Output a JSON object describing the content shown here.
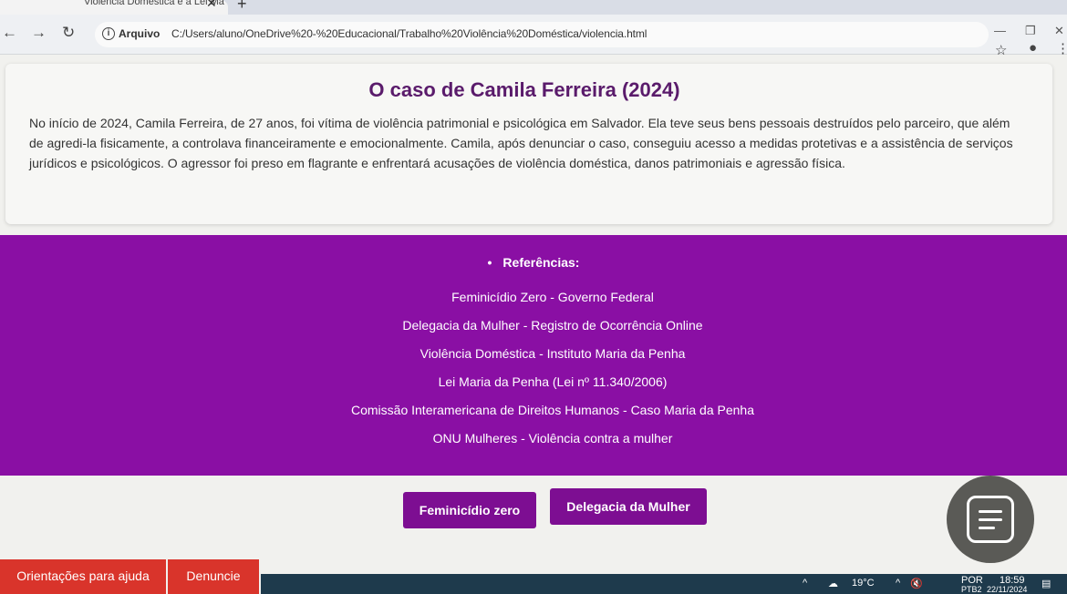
{
  "browser": {
    "tab_title": "Violência Doméstica e a Lei Ma",
    "address_scheme": "Arquivo",
    "url": "C:/Users/aluno/OneDrive%20-%20Educacional/Trabalho%20Violência%20Doméstica/violencia.html"
  },
  "case": {
    "title": "O caso de Camila Ferreira (2024)",
    "text": "No início de 2024, Camila Ferreira, de 27 anos, foi vítima de violência patrimonial e psicológica em Salvador. Ela teve seus bens pessoais destruídos pelo parceiro, que além de agredi-la fisicamente, a controlava financeiramente e emocionalmente. Camila, após denunciar o caso, conseguiu acesso a medidas protetivas e a assistência de serviços jurídicos e psicológicos. O agressor foi preso em flagrante e enfrentará acusações de violência doméstica, danos patrimoniais e agressão física."
  },
  "references": {
    "title": "Referências:",
    "links": [
      "Feminicídio Zero - Governo Federal",
      "Delegacia da Mulher - Registro de Ocorrência Online",
      "Violência Doméstica - Instituto Maria da Penha",
      "Lei Maria da Penha (Lei nº 11.340/2006)",
      "Comissão Interamericana de Direitos Humanos - Caso Maria da Penha",
      "ONU Mulheres - Violência contra a mulher"
    ]
  },
  "buttons": {
    "feminicidio": "Feminicídio zero",
    "delegacia": "Delegacia da Mulher",
    "help": "Orientações para ajuda",
    "denuncie": "Denuncie"
  },
  "taskbar": {
    "temperature": "19°C",
    "language": "POR",
    "keyboard": "PTB2",
    "time": "18:59",
    "date": "22/11/2024"
  },
  "colors": {
    "accent_purple": "#8a0fa4",
    "title_purple": "#5a1b6b",
    "help_red": "#d9342b"
  }
}
